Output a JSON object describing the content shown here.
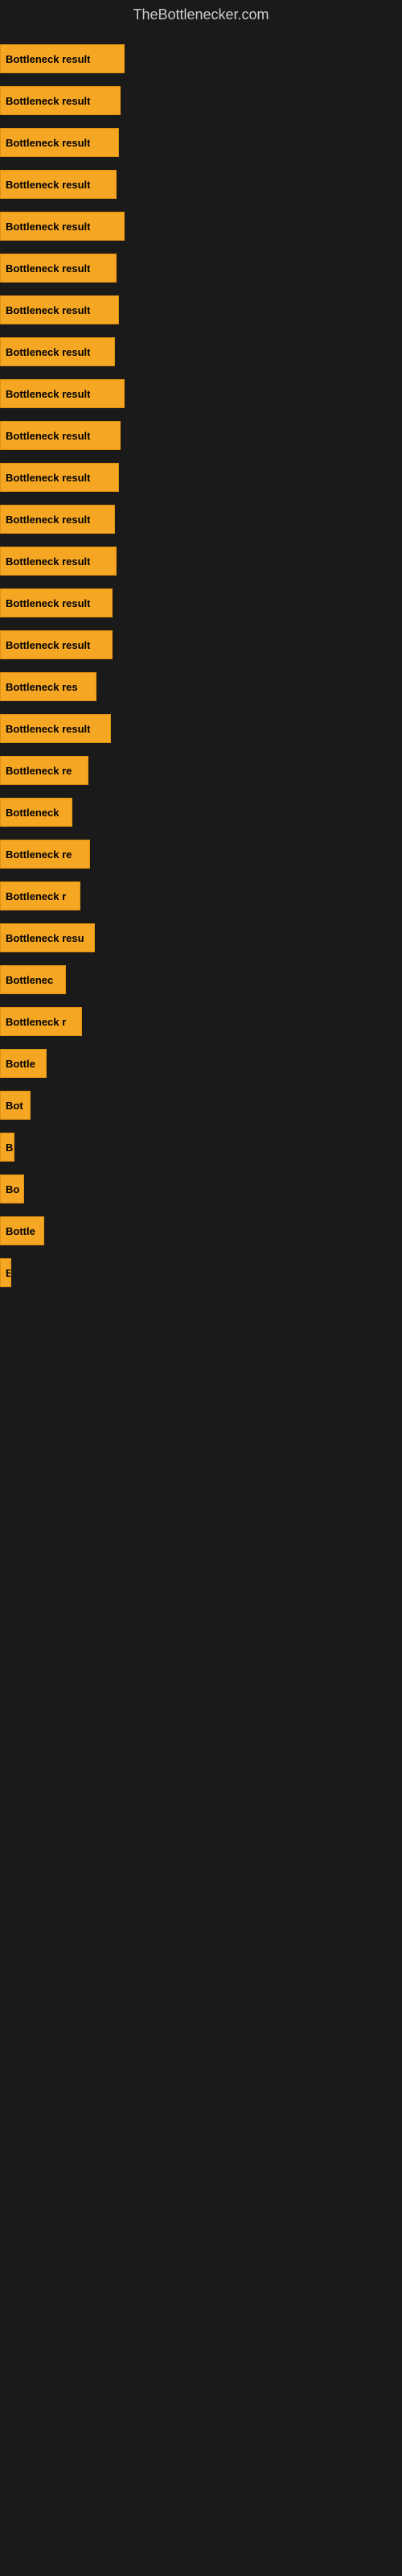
{
  "site": {
    "title": "TheBottlenecker.com"
  },
  "bars": [
    {
      "id": 1,
      "label": "Bottleneck result",
      "width": 155
    },
    {
      "id": 2,
      "label": "Bottleneck result",
      "width": 150
    },
    {
      "id": 3,
      "label": "Bottleneck result",
      "width": 148
    },
    {
      "id": 4,
      "label": "Bottleneck result",
      "width": 145
    },
    {
      "id": 5,
      "label": "Bottleneck result",
      "width": 155
    },
    {
      "id": 6,
      "label": "Bottleneck result",
      "width": 145
    },
    {
      "id": 7,
      "label": "Bottleneck result",
      "width": 148
    },
    {
      "id": 8,
      "label": "Bottleneck result",
      "width": 143
    },
    {
      "id": 9,
      "label": "Bottleneck result",
      "width": 155
    },
    {
      "id": 10,
      "label": "Bottleneck result",
      "width": 150
    },
    {
      "id": 11,
      "label": "Bottleneck result",
      "width": 148
    },
    {
      "id": 12,
      "label": "Bottleneck result",
      "width": 143
    },
    {
      "id": 13,
      "label": "Bottleneck result",
      "width": 145
    },
    {
      "id": 14,
      "label": "Bottleneck result",
      "width": 140
    },
    {
      "id": 15,
      "label": "Bottleneck result",
      "width": 140
    },
    {
      "id": 16,
      "label": "Bottleneck res",
      "width": 120
    },
    {
      "id": 17,
      "label": "Bottleneck result",
      "width": 138
    },
    {
      "id": 18,
      "label": "Bottleneck re",
      "width": 110
    },
    {
      "id": 19,
      "label": "Bottleneck",
      "width": 90
    },
    {
      "id": 20,
      "label": "Bottleneck re",
      "width": 112
    },
    {
      "id": 21,
      "label": "Bottleneck r",
      "width": 100
    },
    {
      "id": 22,
      "label": "Bottleneck resu",
      "width": 118
    },
    {
      "id": 23,
      "label": "Bottlenec",
      "width": 82
    },
    {
      "id": 24,
      "label": "Bottleneck r",
      "width": 102
    },
    {
      "id": 25,
      "label": "Bottle",
      "width": 58
    },
    {
      "id": 26,
      "label": "Bot",
      "width": 38
    },
    {
      "id": 27,
      "label": "B",
      "width": 18
    },
    {
      "id": 28,
      "label": "Bo",
      "width": 30
    },
    {
      "id": 29,
      "label": "Bottle",
      "width": 55
    },
    {
      "id": 30,
      "label": "B",
      "width": 14
    }
  ]
}
